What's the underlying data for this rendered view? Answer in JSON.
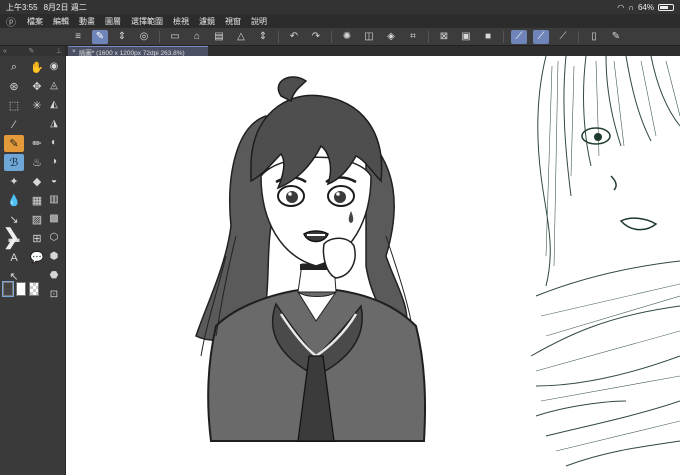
{
  "status": {
    "time": "上午3:55",
    "date": "8月2日 週二",
    "battery": "64%",
    "battery_level": 0.64
  },
  "menu": {
    "items": [
      "檔案",
      "編輯",
      "動畫",
      "圖層",
      "選擇範圍",
      "檢視",
      "濾鏡",
      "視窗",
      "說明"
    ]
  },
  "document": {
    "tab_label": "插圖* (1600 x 1200px 72dpi 263.8%)"
  },
  "colors": {
    "accent": "#6f84b8",
    "active_tool": "#e39a3a",
    "active_tool2": "#6fa6d8"
  }
}
